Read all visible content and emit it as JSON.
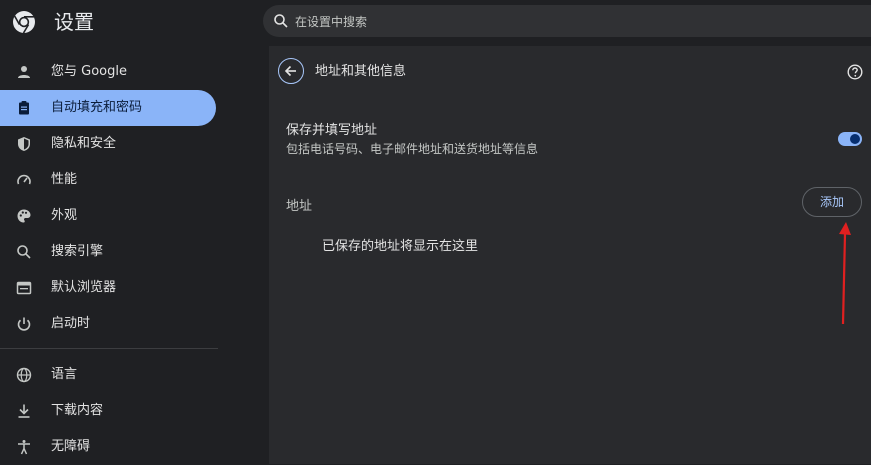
{
  "app": {
    "title": "设置",
    "logo_icon": "chrome-logo-icon"
  },
  "search": {
    "placeholder": "在设置中搜索",
    "value": ""
  },
  "sidebar": {
    "items": [
      {
        "label": "您与 Google",
        "icon": "person-icon",
        "active": false
      },
      {
        "label": "自动填充和密码",
        "icon": "clipboard-icon",
        "active": true
      },
      {
        "label": "隐私和安全",
        "icon": "shield-icon",
        "active": false
      },
      {
        "label": "性能",
        "icon": "speedometer-icon",
        "active": false
      },
      {
        "label": "外观",
        "icon": "palette-icon",
        "active": false
      },
      {
        "label": "搜索引擎",
        "icon": "search-icon",
        "active": false
      },
      {
        "label": "默认浏览器",
        "icon": "browser-icon",
        "active": false
      },
      {
        "label": "启动时",
        "icon": "power-icon",
        "active": false
      },
      {
        "label": "语言",
        "icon": "globe-icon",
        "active": false
      },
      {
        "label": "下载内容",
        "icon": "download-icon",
        "active": false
      },
      {
        "label": "无障碍",
        "icon": "accessibility-icon",
        "active": false
      }
    ]
  },
  "main": {
    "page_title": "地址和其他信息",
    "setting": {
      "title": "保存并填写地址",
      "description": "包括电话号码、电子邮件地址和送货地址等信息",
      "enabled": true
    },
    "section_label": "地址",
    "add_label": "添加",
    "empty_message": "已保存的地址将显示在这里"
  },
  "colors": {
    "accent": "#8ab4f8",
    "annotation_arrow": "#e02020"
  }
}
